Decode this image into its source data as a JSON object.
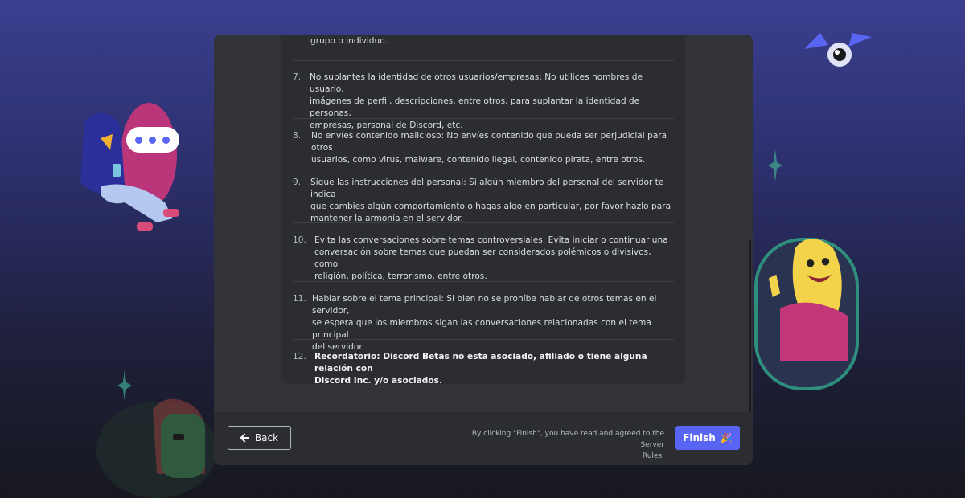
{
  "rules": {
    "prev_tail": "grupo o individuo.",
    "items": [
      {
        "num": "7.",
        "lines": [
          "No suplantes la identidad de otros usuarios/empresas: No utilices nombres de usuario,",
          "imágenes de perfil, descripciones, entre otros, para suplantar la identidad de personas,",
          "empresas, personal de Discord, etc."
        ]
      },
      {
        "num": "8.",
        "lines": [
          "No envíes contenido malicioso: No envíes contenido que pueda ser perjudicial para otros",
          "usuarios, como virus, malware, contenido ilegal, contenido pirata, entre otros."
        ]
      },
      {
        "num": "9.",
        "lines": [
          "Sigue las instrucciones del personal: Si algún miembro del personal del servidor te indica",
          "que cambies algún comportamiento o hagas algo en particular, por favor hazlo para",
          "mantener la armonía en el servidor."
        ]
      },
      {
        "num": "10.",
        "lines": [
          "Evita las conversaciones sobre temas controversiales: Evita iniciar o continuar una",
          "conversación sobre temas que puedan ser considerados polémicos o divisivos, como",
          "religión, política, terrorismo, entre otros."
        ]
      },
      {
        "num": "11.",
        "lines": [
          "Hablar sobre el tema principal: Si bien no se prohíbe hablar de otros temas en el servidor,",
          "se espera que los miembros sigan las conversaciones relacionadas con el tema principal",
          "del servidor."
        ]
      },
      {
        "num": "12.",
        "lines": [
          "Recordatorio: Discord Betas no esta asociado, afiliado o tiene alguna relación con",
          "Discord Inc. y/o asociados."
        ]
      }
    ]
  },
  "footer": {
    "back_label": "Back",
    "back_icon": "arrow-left-icon",
    "agree_line1": "By clicking \"Finish\", you have read and agreed to the Server",
    "agree_line2": "Rules.",
    "finish_label": "Finish",
    "finish_icon": "party-popper-icon",
    "accent": "#5865f2"
  }
}
